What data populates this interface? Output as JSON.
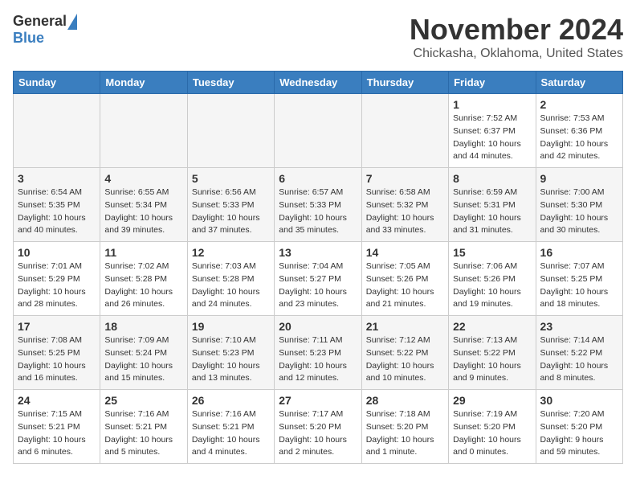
{
  "header": {
    "logo_general": "General",
    "logo_blue": "Blue",
    "month": "November 2024",
    "location": "Chickasha, Oklahoma, United States"
  },
  "weekdays": [
    "Sunday",
    "Monday",
    "Tuesday",
    "Wednesday",
    "Thursday",
    "Friday",
    "Saturday"
  ],
  "weeks": [
    [
      {
        "day": "",
        "info": ""
      },
      {
        "day": "",
        "info": ""
      },
      {
        "day": "",
        "info": ""
      },
      {
        "day": "",
        "info": ""
      },
      {
        "day": "",
        "info": ""
      },
      {
        "day": "1",
        "info": "Sunrise: 7:52 AM\nSunset: 6:37 PM\nDaylight: 10 hours\nand 44 minutes."
      },
      {
        "day": "2",
        "info": "Sunrise: 7:53 AM\nSunset: 6:36 PM\nDaylight: 10 hours\nand 42 minutes."
      }
    ],
    [
      {
        "day": "3",
        "info": "Sunrise: 6:54 AM\nSunset: 5:35 PM\nDaylight: 10 hours\nand 40 minutes."
      },
      {
        "day": "4",
        "info": "Sunrise: 6:55 AM\nSunset: 5:34 PM\nDaylight: 10 hours\nand 39 minutes."
      },
      {
        "day": "5",
        "info": "Sunrise: 6:56 AM\nSunset: 5:33 PM\nDaylight: 10 hours\nand 37 minutes."
      },
      {
        "day": "6",
        "info": "Sunrise: 6:57 AM\nSunset: 5:33 PM\nDaylight: 10 hours\nand 35 minutes."
      },
      {
        "day": "7",
        "info": "Sunrise: 6:58 AM\nSunset: 5:32 PM\nDaylight: 10 hours\nand 33 minutes."
      },
      {
        "day": "8",
        "info": "Sunrise: 6:59 AM\nSunset: 5:31 PM\nDaylight: 10 hours\nand 31 minutes."
      },
      {
        "day": "9",
        "info": "Sunrise: 7:00 AM\nSunset: 5:30 PM\nDaylight: 10 hours\nand 30 minutes."
      }
    ],
    [
      {
        "day": "10",
        "info": "Sunrise: 7:01 AM\nSunset: 5:29 PM\nDaylight: 10 hours\nand 28 minutes."
      },
      {
        "day": "11",
        "info": "Sunrise: 7:02 AM\nSunset: 5:28 PM\nDaylight: 10 hours\nand 26 minutes."
      },
      {
        "day": "12",
        "info": "Sunrise: 7:03 AM\nSunset: 5:28 PM\nDaylight: 10 hours\nand 24 minutes."
      },
      {
        "day": "13",
        "info": "Sunrise: 7:04 AM\nSunset: 5:27 PM\nDaylight: 10 hours\nand 23 minutes."
      },
      {
        "day": "14",
        "info": "Sunrise: 7:05 AM\nSunset: 5:26 PM\nDaylight: 10 hours\nand 21 minutes."
      },
      {
        "day": "15",
        "info": "Sunrise: 7:06 AM\nSunset: 5:26 PM\nDaylight: 10 hours\nand 19 minutes."
      },
      {
        "day": "16",
        "info": "Sunrise: 7:07 AM\nSunset: 5:25 PM\nDaylight: 10 hours\nand 18 minutes."
      }
    ],
    [
      {
        "day": "17",
        "info": "Sunrise: 7:08 AM\nSunset: 5:25 PM\nDaylight: 10 hours\nand 16 minutes."
      },
      {
        "day": "18",
        "info": "Sunrise: 7:09 AM\nSunset: 5:24 PM\nDaylight: 10 hours\nand 15 minutes."
      },
      {
        "day": "19",
        "info": "Sunrise: 7:10 AM\nSunset: 5:23 PM\nDaylight: 10 hours\nand 13 minutes."
      },
      {
        "day": "20",
        "info": "Sunrise: 7:11 AM\nSunset: 5:23 PM\nDaylight: 10 hours\nand 12 minutes."
      },
      {
        "day": "21",
        "info": "Sunrise: 7:12 AM\nSunset: 5:22 PM\nDaylight: 10 hours\nand 10 minutes."
      },
      {
        "day": "22",
        "info": "Sunrise: 7:13 AM\nSunset: 5:22 PM\nDaylight: 10 hours\nand 9 minutes."
      },
      {
        "day": "23",
        "info": "Sunrise: 7:14 AM\nSunset: 5:22 PM\nDaylight: 10 hours\nand 8 minutes."
      }
    ],
    [
      {
        "day": "24",
        "info": "Sunrise: 7:15 AM\nSunset: 5:21 PM\nDaylight: 10 hours\nand 6 minutes."
      },
      {
        "day": "25",
        "info": "Sunrise: 7:16 AM\nSunset: 5:21 PM\nDaylight: 10 hours\nand 5 minutes."
      },
      {
        "day": "26",
        "info": "Sunrise: 7:16 AM\nSunset: 5:21 PM\nDaylight: 10 hours\nand 4 minutes."
      },
      {
        "day": "27",
        "info": "Sunrise: 7:17 AM\nSunset: 5:20 PM\nDaylight: 10 hours\nand 2 minutes."
      },
      {
        "day": "28",
        "info": "Sunrise: 7:18 AM\nSunset: 5:20 PM\nDaylight: 10 hours\nand 1 minute."
      },
      {
        "day": "29",
        "info": "Sunrise: 7:19 AM\nSunset: 5:20 PM\nDaylight: 10 hours\nand 0 minutes."
      },
      {
        "day": "30",
        "info": "Sunrise: 7:20 AM\nSunset: 5:20 PM\nDaylight: 9 hours\nand 59 minutes."
      }
    ]
  ]
}
